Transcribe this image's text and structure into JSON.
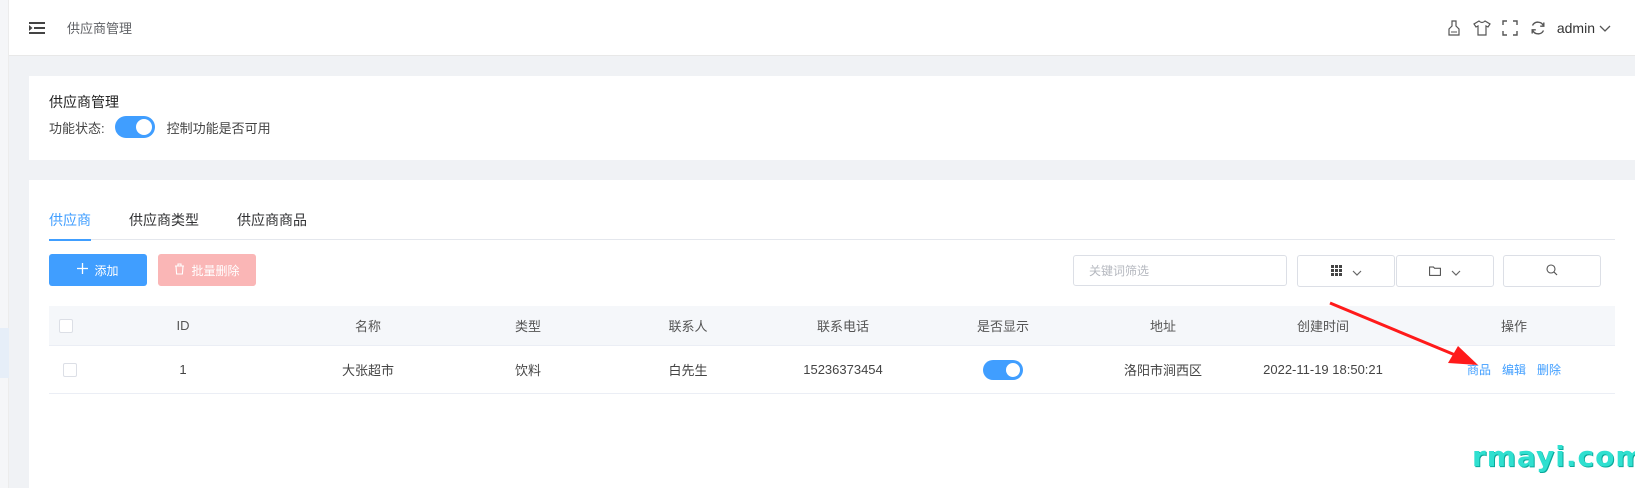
{
  "header": {
    "title": "供应商管理",
    "user": "admin",
    "icons": [
      "menu-fold-icon",
      "clear-cache-icon",
      "skin-icon",
      "fullscreen-icon",
      "refresh-icon",
      "chevron-down-icon"
    ]
  },
  "panel": {
    "title": "供应商管理",
    "status_label": "功能状态:",
    "status_on": true,
    "status_desc": "控制功能是否可用"
  },
  "tabs": [
    {
      "label": "供应商",
      "active": true
    },
    {
      "label": "供应商类型",
      "active": false
    },
    {
      "label": "供应商商品",
      "active": false
    }
  ],
  "toolbar": {
    "add_label": "添加",
    "batch_delete_label": "批量删除",
    "search_placeholder": "关键词筛选"
  },
  "table": {
    "columns": [
      "ID",
      "名称",
      "类型",
      "联系人",
      "联系电话",
      "是否显示",
      "地址",
      "创建时间",
      "操作"
    ],
    "rows": [
      {
        "id": "1",
        "name": "大张超市",
        "type": "饮料",
        "contact": "白先生",
        "phone": "15236373454",
        "visible": true,
        "address": "洛阳市涧西区",
        "created": "2022-11-19 18:50:21",
        "ops": [
          "商品",
          "编辑",
          "删除"
        ]
      }
    ]
  },
  "colors": {
    "primary": "#409eff",
    "danger_light": "#fab6b6",
    "arrow": "#ff1a1a",
    "watermark": "#2fe0d0"
  },
  "watermark": "rmayi.com"
}
